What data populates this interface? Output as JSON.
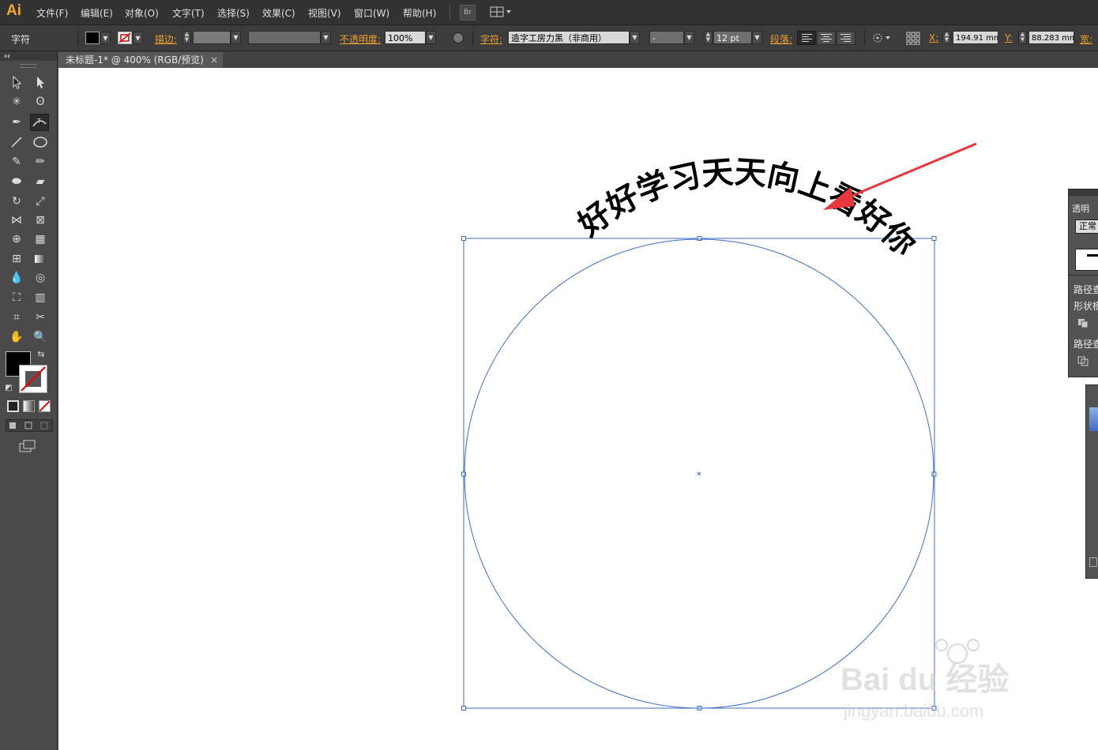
{
  "app": {
    "logo": "Ai"
  },
  "menu": [
    {
      "label": "文件(F)"
    },
    {
      "label": "编辑(E)"
    },
    {
      "label": "对象(O)"
    },
    {
      "label": "文字(T)"
    },
    {
      "label": "选择(S)"
    },
    {
      "label": "效果(C)"
    },
    {
      "label": "视图(V)"
    },
    {
      "label": "窗口(W)"
    },
    {
      "label": "帮助(H)"
    }
  ],
  "menu_extras": {
    "bridge_label": "Br"
  },
  "control": {
    "mode_label": "字符",
    "stroke_label": "描边:",
    "opacity_label": "不透明度:",
    "opacity_value": "100%",
    "char_label": "字符:",
    "font_name": "造字工房力黑（非商用）",
    "font_style": "-",
    "font_size": "12 pt",
    "para_label": "段落:",
    "x_label": "X:",
    "x_value": "194.91 mm",
    "y_label": "Y:",
    "y_value": "88.283 mm",
    "w_label": "宽:"
  },
  "document": {
    "tab_title": "未标题-1* @ 400% (RGB/预览)",
    "close_glyph": "×"
  },
  "artwork": {
    "path_text": "好好学习天天向上看好你",
    "text_color": "#000000",
    "path_color": "#3d6fc4",
    "arrow_color": "#e8383d"
  },
  "right_panel": {
    "transparency_title": "透明",
    "blend_mode": "正常",
    "pathfinder_label": "路径查",
    "shape_mode_label": "形状模",
    "pathfinder_label2": "路径查"
  },
  "watermark": {
    "brand": "Bai du 经验",
    "url": "jingyan.baidu.com"
  },
  "colors": {
    "fill": "#000000",
    "stroke": "none",
    "accent": "#f0a030"
  }
}
